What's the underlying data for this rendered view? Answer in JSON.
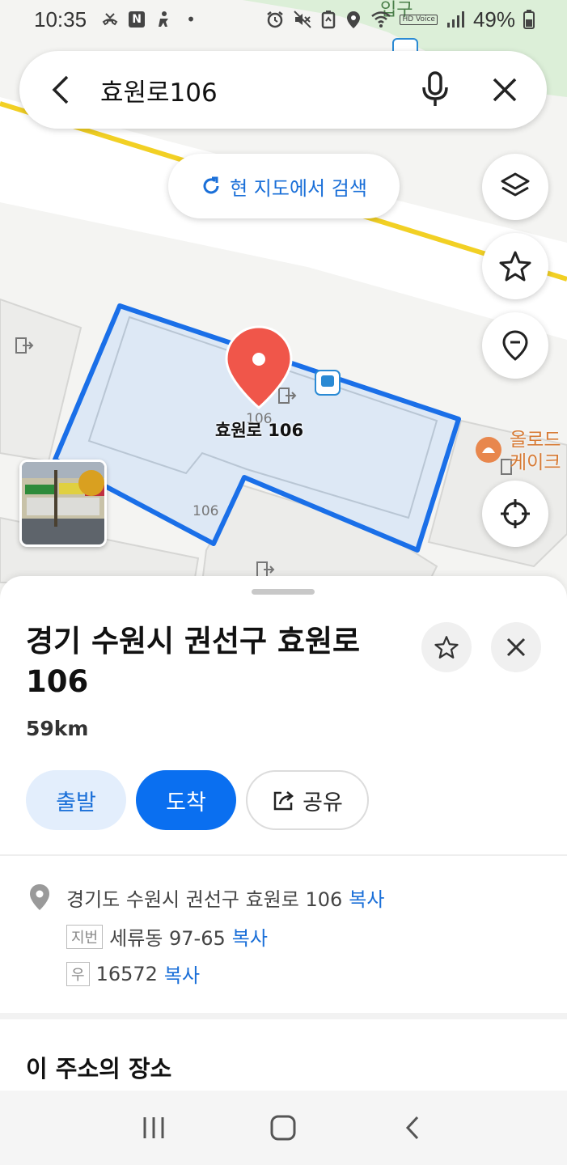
{
  "status_bar": {
    "time": "10:35",
    "battery": "49%",
    "hd_voice": "HD Voice",
    "icons_left": [
      "missed-call-icon",
      "n-app-icon",
      "accessibility-icon",
      "dot-icon"
    ],
    "icons_right": [
      "alarm-icon",
      "mute-icon",
      "battery-saver-icon",
      "location-icon",
      "wifi-icon",
      "signal-icon",
      "battery-icon"
    ]
  },
  "search": {
    "query": "효원로106"
  },
  "map": {
    "research_label": "현 지도에서 검색",
    "place_label": "효원로 106",
    "building_number": "106",
    "building_number_small": "106",
    "poi_name_line1": "올로드",
    "poi_name_line2": "케이크",
    "top_label": "입구"
  },
  "sheet": {
    "title": "경기 수원시 권선구 효원로 106",
    "distance": "59km",
    "actions": {
      "depart": "출발",
      "arrive": "도착",
      "share": "공유"
    },
    "address": {
      "road": "경기도 수원시 권선구 효원로 106",
      "jibun_tag": "지번",
      "jibun": "세류동 97-65",
      "zip_tag": "우",
      "zip": "16572",
      "copy": "복사"
    },
    "section_title": "이 주소의 장소"
  },
  "colors": {
    "accent": "#0a6ff0",
    "link": "#1a6fd8",
    "pin": "#f0564a",
    "outline": "#1a6fe8",
    "road": "#f2d024",
    "poi": "#d77a34"
  }
}
